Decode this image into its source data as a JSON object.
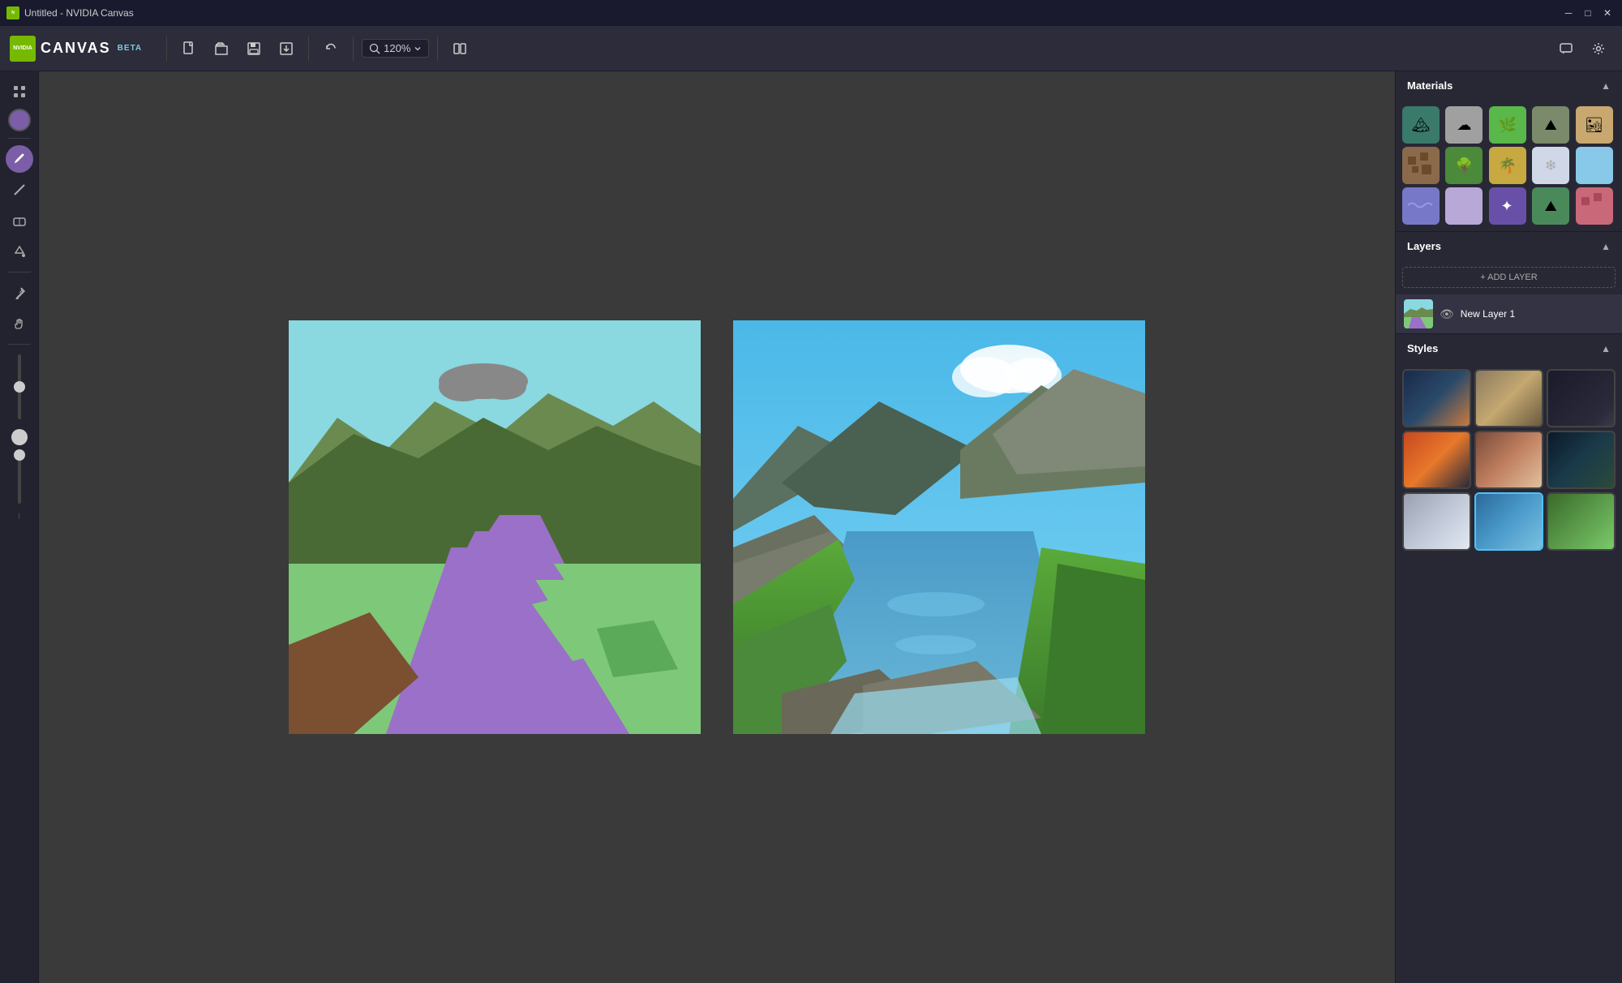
{
  "window": {
    "title": "Untitled - NVIDIA Canvas"
  },
  "titlebar": {
    "title": "Untitled - NVIDIA Canvas",
    "min_label": "─",
    "max_label": "□",
    "close_label": "✕"
  },
  "toolbar": {
    "app_title": "CANVAS",
    "app_beta": "BETA",
    "new_label": "New",
    "open_label": "Open",
    "save_label": "Save",
    "export_label": "Export",
    "undo_label": "Undo",
    "zoom_value": "120%",
    "compare_label": "Compare",
    "chat_label": "Chat",
    "settings_label": "Settings"
  },
  "tools": {
    "items": [
      {
        "name": "paint-brush",
        "icon": "✏",
        "active": true
      },
      {
        "name": "line-tool",
        "icon": "╱",
        "active": false
      },
      {
        "name": "eraser",
        "icon": "◻",
        "active": false
      },
      {
        "name": "fill",
        "icon": "⬦",
        "active": false
      },
      {
        "name": "eyedropper",
        "icon": "🖊",
        "active": false
      },
      {
        "name": "hand",
        "icon": "✋",
        "active": false
      }
    ],
    "color": "#7b5ea7"
  },
  "materials": {
    "title": "Materials",
    "items": [
      {
        "name": "water-mountain",
        "color": "#3a7a6a",
        "icon": "🏔",
        "bg": "#3a7a6a"
      },
      {
        "name": "cloud",
        "color": "#b0b0b0",
        "icon": "☁",
        "bg": "#a0a0a0"
      },
      {
        "name": "grass-bright",
        "color": "#5ab84a",
        "icon": "🌿",
        "bg": "#5ab84a"
      },
      {
        "name": "rock-mountain",
        "color": "#8a7a6a",
        "icon": "⛰",
        "bg": "#7a8a6a"
      },
      {
        "name": "sand",
        "color": "#c8a870",
        "icon": "🏜",
        "bg": "#c8a870"
      },
      {
        "name": "dirt",
        "color": "#8a6a4a",
        "icon": "▦",
        "bg": "#8a6a4a"
      },
      {
        "name": "tree",
        "color": "#4a8a3a",
        "icon": "🌳",
        "bg": "#4a8a3a"
      },
      {
        "name": "tropical",
        "color": "#c8a840",
        "icon": "🌴",
        "bg": "#c8a840"
      },
      {
        "name": "snow",
        "color": "#d0d8e8",
        "icon": "❄",
        "bg": "#d0d8e8"
      },
      {
        "name": "light-blue",
        "color": "#88c8e8",
        "icon": "◻",
        "bg": "#88c8e8"
      },
      {
        "name": "water-purple",
        "color": "#7878c8",
        "icon": "〰",
        "bg": "#7878c8"
      },
      {
        "name": "lavender",
        "color": "#b8a8d8",
        "icon": "◻",
        "bg": "#b8a8d8"
      },
      {
        "name": "purple-sparkle",
        "color": "#6850a8",
        "icon": "✦",
        "bg": "#6850a8"
      },
      {
        "name": "green-mountain",
        "color": "#4a8a5a",
        "icon": "⛰",
        "bg": "#4a8a5a"
      },
      {
        "name": "pink-texture",
        "color": "#c86878",
        "icon": "▦",
        "bg": "#c86878"
      }
    ]
  },
  "layers": {
    "title": "Layers",
    "add_label": "+ ADD LAYER",
    "items": [
      {
        "name": "New Layer 1",
        "visible": true
      }
    ]
  },
  "styles": {
    "title": "Styles",
    "items": [
      {
        "name": "mountain-sunset",
        "class": "style-1"
      },
      {
        "name": "desert-mist",
        "class": "style-2"
      },
      {
        "name": "dark-cave",
        "class": "style-3"
      },
      {
        "name": "volcanic-sunset",
        "class": "style-4"
      },
      {
        "name": "canyon-warm",
        "class": "style-5"
      },
      {
        "name": "deep-ocean",
        "class": "style-6"
      },
      {
        "name": "misty-peaks",
        "class": "style-7"
      },
      {
        "name": "tropical-lake",
        "class": "style-8",
        "active": true
      },
      {
        "name": "green-valley",
        "class": "style-9"
      }
    ]
  }
}
